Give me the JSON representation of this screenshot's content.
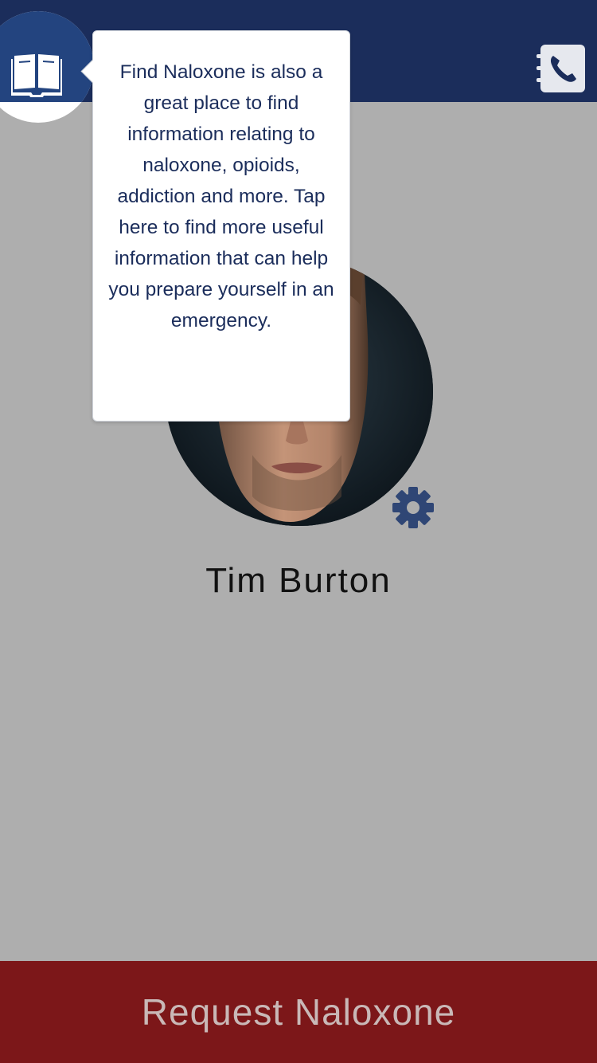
{
  "header": {
    "library_icon": "open-book-icon",
    "contacts_icon": "phone-contacts-icon",
    "color": "#1b2d5b"
  },
  "tooltip": {
    "text": "Find Naloxone is also a great place to find information relating to naloxone, opioids, addiction and more. Tap here to find more useful information that can help you prepare yourself in an emergency."
  },
  "profile": {
    "name": "Tim Burton",
    "photo": "profile-photo",
    "settings_icon": "gear-icon"
  },
  "footer": {
    "request_label": "Request Naloxone",
    "color": "#7c1719"
  }
}
